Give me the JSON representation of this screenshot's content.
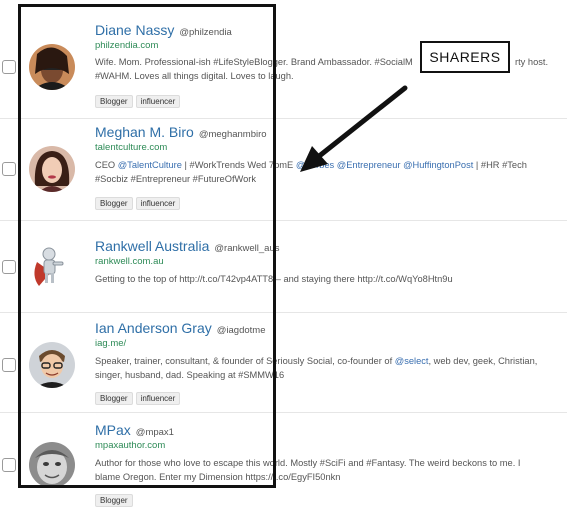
{
  "sharers": [
    {
      "name": "Diane Nassy",
      "handle": "@philzendia",
      "site": "philzendia.com",
      "bio": "Wife. Mom. Professional-ish #LifeStyleBlogger. Brand Ambassador. #SocialM",
      "bio_tail": "rty host.",
      "bio_line2": "#WAHM. Loves all things digital. Loves to laugh.",
      "tags": [
        "Blogger",
        "influencer"
      ]
    },
    {
      "name": "Meghan M. Biro",
      "handle": "@meghanmbiro",
      "site": "talentculture.com",
      "bio_pre": "CEO ",
      "bio_m1": "@TalentCulture",
      "bio_mid": " | #WorkTrends Wed 7pmE",
      "bio_m2": "@Forbes",
      "bio_m3": "@Entrepreneur",
      "bio_m4": "@HuffingtonPost",
      "bio_post": " | #HR #Tech",
      "bio_line2": "#Socbiz #Entrepreneur #FutureOfWork",
      "tags": [
        "Blogger",
        "influencer"
      ]
    },
    {
      "name": "Rankwell Australia",
      "handle": "@rankwell_aus",
      "site": "rankwell.com.au",
      "bio": "Getting to the top of http://t.co/T42vp4ATT8 – and staying there http://t.co/WqYo8Htn9u"
    },
    {
      "name": "Ian Anderson Gray",
      "handle": "@iagdotme",
      "site": "iag.me/",
      "bio_pre": "Speaker, trainer, consultant, & founder of Seriously Social, co-founder of ",
      "bio_m1": "@select",
      "bio_post": ", web dev, geek, Christian,",
      "bio_line2": "singer, husband, dad. Speaking at #SMMW16",
      "tags": [
        "Blogger",
        "influencer"
      ]
    },
    {
      "name": "MPax",
      "handle": "@mpax1",
      "site": "mpaxauthor.com",
      "bio": "Author for those who love to escape this world. Mostly #SciFi and #Fantasy. The weird beckons to me. I",
      "bio_line2": "blame Oregon. Enter my Dimension https://t.co/EgyFI50nkn",
      "tags": [
        "Blogger"
      ]
    }
  ],
  "annotation": {
    "label": "SHARERS"
  },
  "colors": {
    "name": "#2f6fa7",
    "site": "#2e8b57",
    "mention": "#3a6fb0",
    "frame": "#111111"
  }
}
